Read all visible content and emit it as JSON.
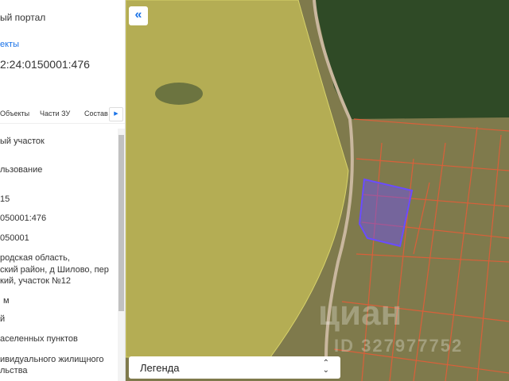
{
  "panel": {
    "portal_title": "ый портал",
    "objects_link": "екты",
    "cadastral_number": "2:24:0150001:476",
    "tabs": [
      "Объекты",
      "Части ЗУ",
      "Состав"
    ],
    "tabs_next_icon": "caret-right-icon",
    "fields": [
      "ый участок",
      "льзование",
      "15",
      "050001:476",
      "050001",
      "родская область,",
      "ский район, д Шилово, пер",
      "кий, участок №12",
      "м",
      "й",
      "аселенных пунктов",
      "ивидуального жилищного",
      "льства"
    ]
  },
  "map": {
    "collapse_icon": "double-chevron-left-icon",
    "legend_label": "Легенда",
    "watermark": "циан",
    "watermark_id": "ID 327977752",
    "selected_plot_color": "#6a4cff"
  }
}
